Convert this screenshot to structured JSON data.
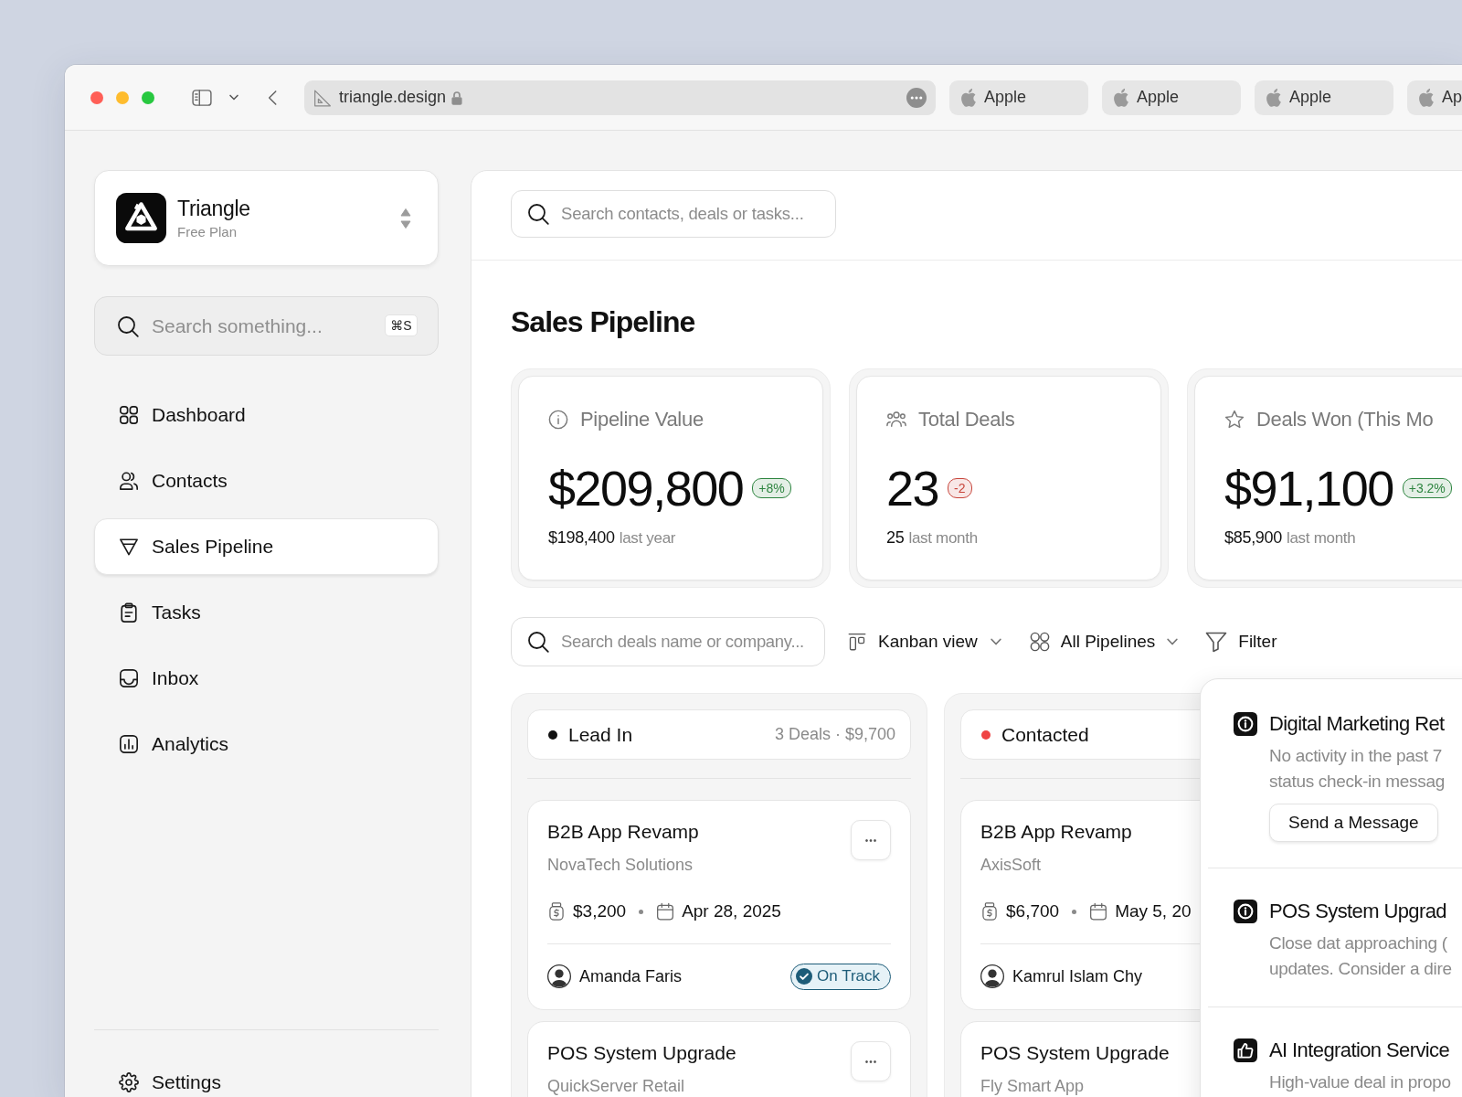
{
  "browser": {
    "url": "triangle.design",
    "tabs": [
      {
        "label": "Apple",
        "selected": false
      },
      {
        "label": "Apple",
        "selected": false
      },
      {
        "label": "Apple",
        "selected": false
      },
      {
        "label": "Ap",
        "selected": false
      }
    ]
  },
  "workspace": {
    "name": "Triangle",
    "plan": "Free Plan"
  },
  "sidebar_search": {
    "placeholder": "Search something...",
    "shortcut": "⌘S"
  },
  "nav": [
    {
      "label": "Dashboard",
      "selected": false
    },
    {
      "label": "Contacts",
      "selected": false
    },
    {
      "label": "Sales Pipeline",
      "selected": true
    },
    {
      "label": "Tasks",
      "selected": false
    },
    {
      "label": "Inbox",
      "selected": false
    },
    {
      "label": "Analytics",
      "selected": false
    }
  ],
  "settings": {
    "label": "Settings"
  },
  "header_search": {
    "placeholder": "Search contacts, deals or tasks..."
  },
  "page_title": "Sales Pipeline",
  "stats": [
    {
      "label": "Pipeline Value",
      "value": "$209,800",
      "change": "+8%",
      "color": "#2e8540",
      "previous": "$198,400",
      "period": "last year"
    },
    {
      "label": "Total Deals",
      "value": "23",
      "change": "-2",
      "color": "#c8463c",
      "previous": "25",
      "period": "last month"
    },
    {
      "label": "Deals Won (This Mo",
      "value": "$91,100",
      "change": "+3.2%",
      "color": "#2e8540",
      "previous": "$85,900",
      "period": "last month"
    }
  ],
  "toolbar": {
    "search_placeholder": "Search deals name or company...",
    "view": "Kanban view",
    "pipelines": "All Pipelines",
    "filter": "Filter"
  },
  "columns": [
    {
      "name": "Lead In",
      "color": "#111111",
      "summary": "3 Deals · $9,700",
      "deals": [
        {
          "title": "B2B App Revamp",
          "company": "NovaTech Solutions",
          "more": "•••",
          "amount": "$3,200",
          "date": "Apr 28, 2025",
          "owner": "Amanda Faris",
          "status": "On Track"
        },
        {
          "title": "POS System Upgrade",
          "company": "QuickServer Retail",
          "more": "•••"
        }
      ]
    },
    {
      "name": "Contacted",
      "color": "#ef4444",
      "deals": [
        {
          "title": "B2B App Revamp",
          "company": "AxisSoft",
          "amount": "$6,700",
          "date": "May 5, 20",
          "owner": "Kamrul Islam Chy"
        },
        {
          "title": "POS System Upgrade",
          "company": "Fly Smart App"
        }
      ]
    }
  ],
  "notifications": [
    {
      "kind": "alert",
      "title": "Digital Marketing Ret",
      "lines": [
        "No activity in the past 7",
        "status check-in messag"
      ],
      "action": "Send a Message"
    },
    {
      "kind": "alert",
      "title": "POS System Upgrad",
      "lines": [
        "Close dat approaching (",
        "updates. Consider a dire"
      ]
    },
    {
      "kind": "positive",
      "title": "AI Integration Service",
      "lines": [
        "High-value deal in propo"
      ]
    }
  ]
}
